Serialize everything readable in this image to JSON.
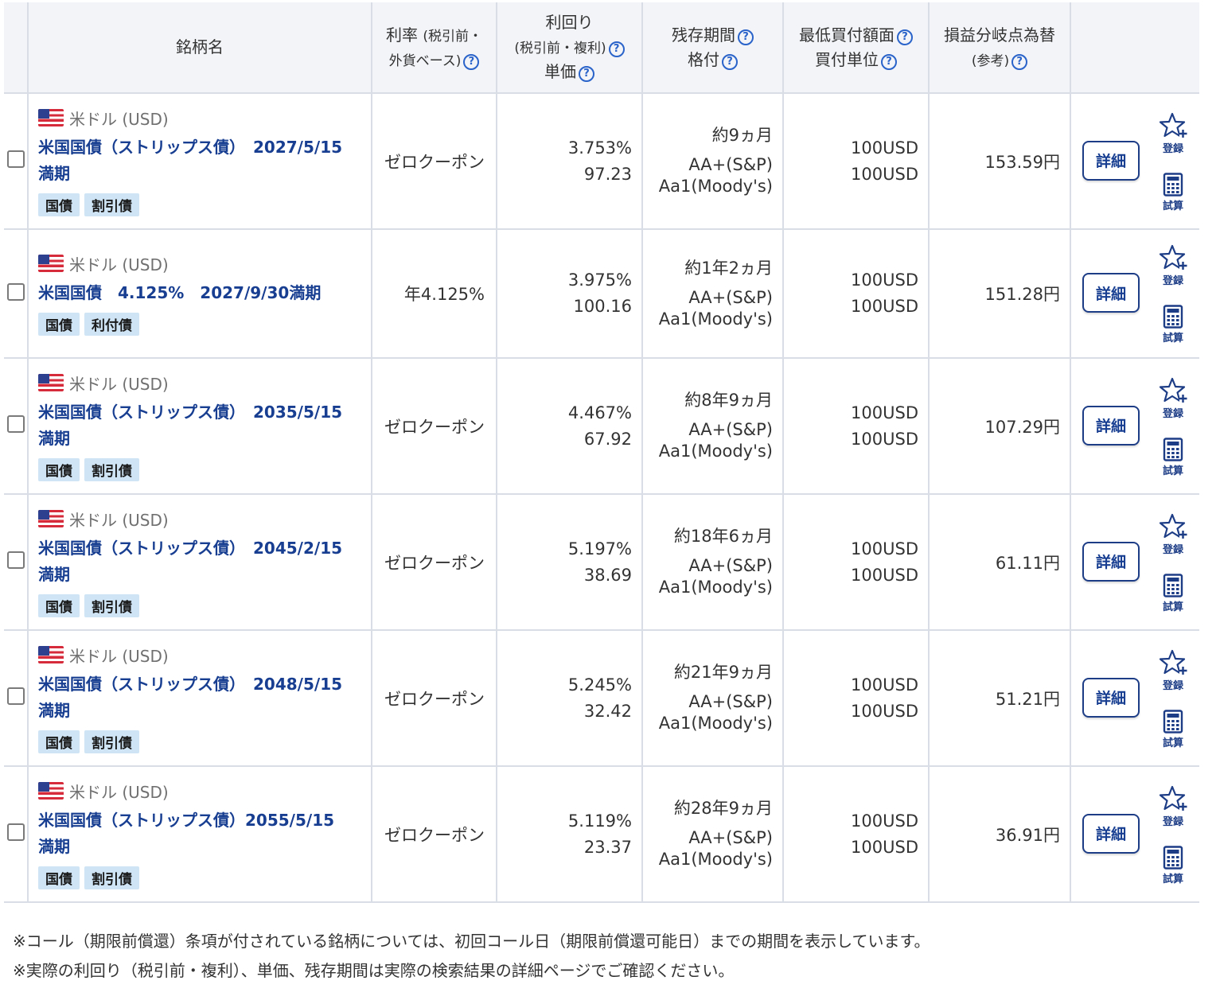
{
  "header": {
    "name": "銘柄名",
    "rate_line1": "利率",
    "rate_small1": "(税引前・",
    "rate_line2": "外貨ベース)",
    "yield_line1": "利回り",
    "yield_line2": "(税引前・複利)",
    "yield_line3": "単価",
    "term_line1": "残存期間",
    "term_line2": "格付",
    "min_line1": "最低買付額面",
    "min_line2": "買付単位",
    "be_line1": "損益分岐点為替",
    "be_line2": "(参考)",
    "help_glyph": "?"
  },
  "actions": {
    "detail_label": "詳細",
    "register_label": "登録",
    "calc_label": "試算"
  },
  "rows": [
    {
      "currency": "米ドル (USD)",
      "name_line1": "米国国債（ストリップス債）　2027/5/15",
      "name_line2": "満期",
      "tag1": "国債",
      "tag2": "割引債",
      "rate": "ゼロクーポン",
      "yield": "3.753%",
      "price": "97.23",
      "term": "約9ヵ月",
      "rating_sp": "AA+(S&P)",
      "rating_moodys": "Aa1(Moody's)",
      "min_face": "100USD",
      "unit": "100USD",
      "breakeven": "153.59円"
    },
    {
      "currency": "米ドル (USD)",
      "name_line1": "米国国債　4.125%　2027/9/30満期",
      "name_line2": "",
      "tag1": "国債",
      "tag2": "利付債",
      "rate": "年4.125%",
      "yield": "3.975%",
      "price": "100.16",
      "term": "約1年2ヵ月",
      "rating_sp": "AA+(S&P)",
      "rating_moodys": "Aa1(Moody's)",
      "min_face": "100USD",
      "unit": "100USD",
      "breakeven": "151.28円"
    },
    {
      "currency": "米ドル (USD)",
      "name_line1": "米国国債（ストリップス債）　2035/5/15",
      "name_line2": "満期",
      "tag1": "国債",
      "tag2": "割引債",
      "rate": "ゼロクーポン",
      "yield": "4.467%",
      "price": "67.92",
      "term": "約8年9ヵ月",
      "rating_sp": "AA+(S&P)",
      "rating_moodys": "Aa1(Moody's)",
      "min_face": "100USD",
      "unit": "100USD",
      "breakeven": "107.29円"
    },
    {
      "currency": "米ドル (USD)",
      "name_line1": "米国国債（ストリップス債）　2045/2/15",
      "name_line2": "満期",
      "tag1": "国債",
      "tag2": "割引債",
      "rate": "ゼロクーポン",
      "yield": "5.197%",
      "price": "38.69",
      "term": "約18年6ヵ月",
      "rating_sp": "AA+(S&P)",
      "rating_moodys": "Aa1(Moody's)",
      "min_face": "100USD",
      "unit": "100USD",
      "breakeven": "61.11円"
    },
    {
      "currency": "米ドル (USD)",
      "name_line1": "米国国債（ストリップス債）　2048/5/15",
      "name_line2": "満期",
      "tag1": "国債",
      "tag2": "割引債",
      "rate": "ゼロクーポン",
      "yield": "5.245%",
      "price": "32.42",
      "term": "約21年9ヵ月",
      "rating_sp": "AA+(S&P)",
      "rating_moodys": "Aa1(Moody's)",
      "min_face": "100USD",
      "unit": "100USD",
      "breakeven": "51.21円"
    },
    {
      "currency": "米ドル (USD)",
      "name_line1": "米国国債（ストリップス債）2055/5/15",
      "name_line2": "満期",
      "tag1": "国債",
      "tag2": "割引債",
      "rate": "ゼロクーポン",
      "yield": "5.119%",
      "price": "23.37",
      "term": "約28年9ヵ月",
      "rating_sp": "AA+(S&P)",
      "rating_moodys": "Aa1(Moody's)",
      "min_face": "100USD",
      "unit": "100USD",
      "breakeven": "36.91円"
    }
  ],
  "notes": [
    "※コール（期限前償還）条項が付されている銘柄については、初回コール日（期限前償還可能日）までの期間を表示しています。",
    "※実際の利回り（税引前・複利）、単価、残存期間は実際の検索結果の詳細ページでご確認ください。"
  ],
  "colors": {
    "accent": "#173e91",
    "help": "#2a63c9",
    "tag_bg": "#cfe5f5",
    "header_bg": "#f2f4f8",
    "border": "#d8dde6"
  },
  "icons": {
    "flag": "us-flag-icon",
    "register": "star-plus-icon",
    "calc": "calculator-icon",
    "help": "question-circle-icon"
  }
}
